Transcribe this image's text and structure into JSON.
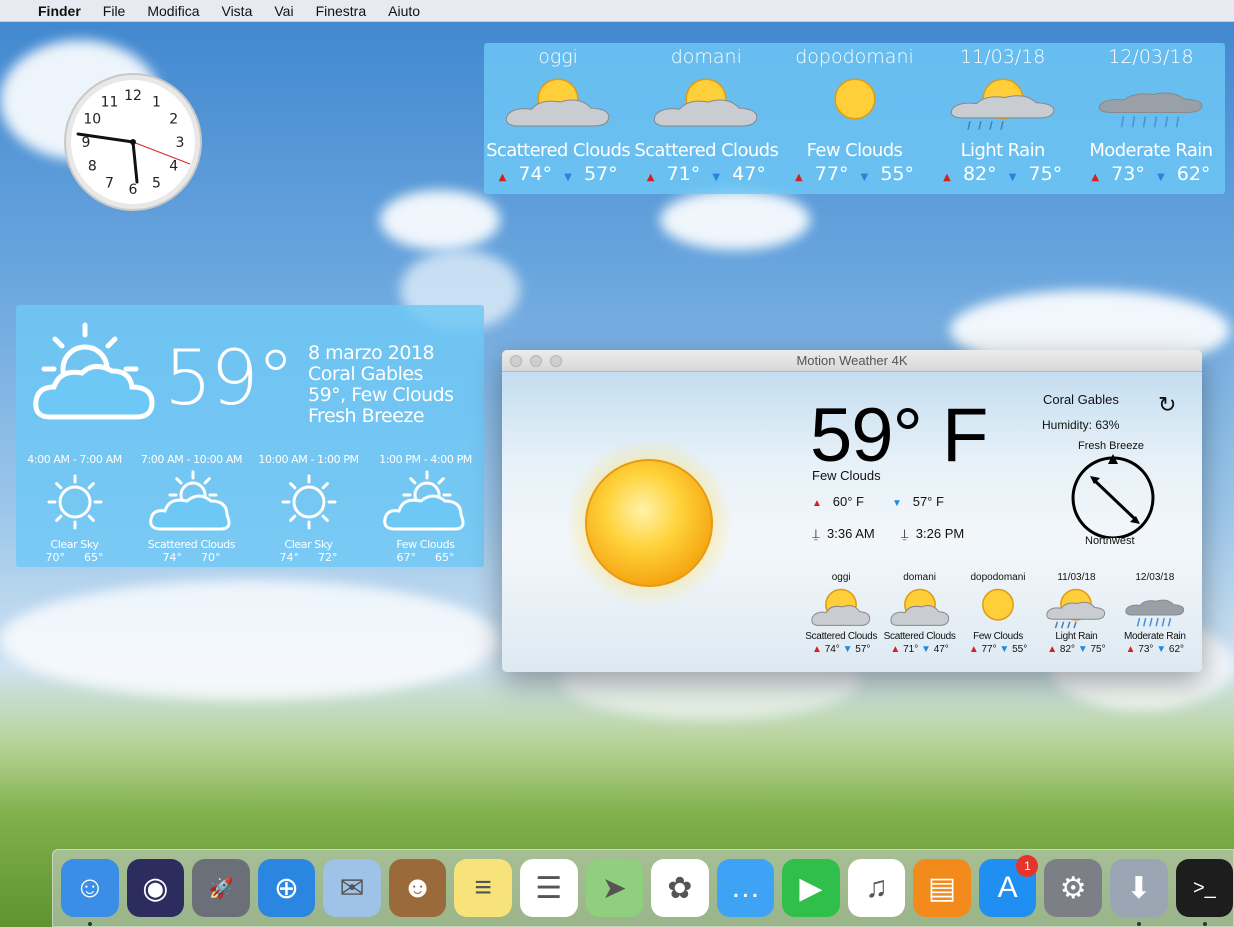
{
  "menubar": {
    "app": "Finder",
    "items": [
      "File",
      "Modifica",
      "Vista",
      "Vai",
      "Finestra",
      "Aiuto"
    ]
  },
  "clock": {
    "numbers": [
      "12",
      "1",
      "2",
      "3",
      "4",
      "5",
      "6",
      "7",
      "8",
      "9",
      "10",
      "11"
    ]
  },
  "forecast": [
    {
      "day": "oggi",
      "condition": "Scattered Clouds",
      "high": "74°",
      "low": "57°",
      "icon": "scattered-clouds"
    },
    {
      "day": "domani",
      "condition": "Scattered Clouds",
      "high": "71°",
      "low": "47°",
      "icon": "scattered-clouds"
    },
    {
      "day": "dopodomani",
      "condition": "Few Clouds",
      "high": "77°",
      "low": "55°",
      "icon": "few-clouds"
    },
    {
      "day": "11/03/18",
      "condition": "Light Rain",
      "high": "82°",
      "low": "75°",
      "icon": "light-rain"
    },
    {
      "day": "12/03/18",
      "condition": "Moderate Rain",
      "high": "73°",
      "low": "62°",
      "icon": "moderate-rain"
    }
  ],
  "current_widget": {
    "temp": "59°",
    "date": "8 marzo 2018",
    "city": "Coral Gables",
    "summary": "59°, Few Clouds",
    "wind": "Fresh Breeze",
    "slots": [
      {
        "time": "4:00 AM - 7:00 AM",
        "condition": "Clear Sky",
        "t1": "70°",
        "t2": "65°",
        "icon": "clear-sky"
      },
      {
        "time": "7:00 AM - 10:00 AM",
        "condition": "Scattered Clouds",
        "t1": "74°",
        "t2": "70°",
        "icon": "scattered-clouds"
      },
      {
        "time": "10:00 AM - 1:00 PM",
        "condition": "Clear Sky",
        "t1": "74°",
        "t2": "72°",
        "icon": "clear-sky"
      },
      {
        "time": "1:00 PM - 4:00 PM",
        "condition": "Few Clouds",
        "t1": "67°",
        "t2": "65°",
        "icon": "few-clouds"
      }
    ]
  },
  "window": {
    "title": "Motion Weather 4K",
    "temp": "59° F",
    "condition": "Few Clouds",
    "high": "60° F",
    "low": "57° F",
    "sunrise": "3:36 AM",
    "sunset": "3:26 PM",
    "city": "Coral Gables",
    "humidity": "Humidity: 63%",
    "wind_label": "Fresh Breeze",
    "wind_dir": "Northwest",
    "mini": [
      {
        "day": "oggi",
        "condition": "Scattered Clouds",
        "high": "74°",
        "low": "57°",
        "icon": "scattered-clouds"
      },
      {
        "day": "domani",
        "condition": "Scattered Clouds",
        "high": "71°",
        "low": "47°",
        "icon": "scattered-clouds"
      },
      {
        "day": "dopodomani",
        "condition": "Few Clouds",
        "high": "77°",
        "low": "55°",
        "icon": "few-clouds"
      },
      {
        "day": "11/03/18",
        "condition": "Light Rain",
        "high": "82°",
        "low": "75°",
        "icon": "light-rain"
      },
      {
        "day": "12/03/18",
        "condition": "Moderate Rain",
        "high": "73°",
        "low": "62°",
        "icon": "moderate-rain"
      }
    ]
  },
  "dock": [
    {
      "name": "finder",
      "color": "#3a8ee6",
      "glyph": "☺"
    },
    {
      "name": "siri",
      "color": "#2c2c5e",
      "glyph": "◉"
    },
    {
      "name": "launchpad",
      "color": "#6b6f78",
      "glyph": "🚀"
    },
    {
      "name": "safari",
      "color": "#2a86e0",
      "glyph": "⊕"
    },
    {
      "name": "mail",
      "color": "#9fc3e8",
      "glyph": "✉"
    },
    {
      "name": "contacts",
      "color": "#9a6a3a",
      "glyph": "☻"
    },
    {
      "name": "notes",
      "color": "#f8e27a",
      "glyph": "≡"
    },
    {
      "name": "reminders",
      "color": "#ffffff",
      "glyph": "☰"
    },
    {
      "name": "maps",
      "color": "#8fcf7e",
      "glyph": "➤"
    },
    {
      "name": "photos",
      "color": "#ffffff",
      "glyph": "✿"
    },
    {
      "name": "messages",
      "color": "#3fa3f5",
      "glyph": "…"
    },
    {
      "name": "facetime",
      "color": "#2fbf4a",
      "glyph": "▶"
    },
    {
      "name": "itunes",
      "color": "#ffffff",
      "glyph": "♫"
    },
    {
      "name": "ibooks",
      "color": "#f28a1c",
      "glyph": "▤"
    },
    {
      "name": "app-store",
      "color": "#1f8ff2",
      "glyph": "A",
      "badge": "1"
    },
    {
      "name": "system-preferences",
      "color": "#7c7f85",
      "glyph": "⚙"
    },
    {
      "name": "downloads",
      "color": "#9aa6b3",
      "glyph": "⬇"
    },
    {
      "name": "terminal",
      "color": "#1d1d1d",
      "glyph": ">_"
    }
  ],
  "colors": {
    "high_arrow": "#d62020",
    "low_arrow": "#2488d8",
    "widget_bg": "#6ec8f5"
  }
}
